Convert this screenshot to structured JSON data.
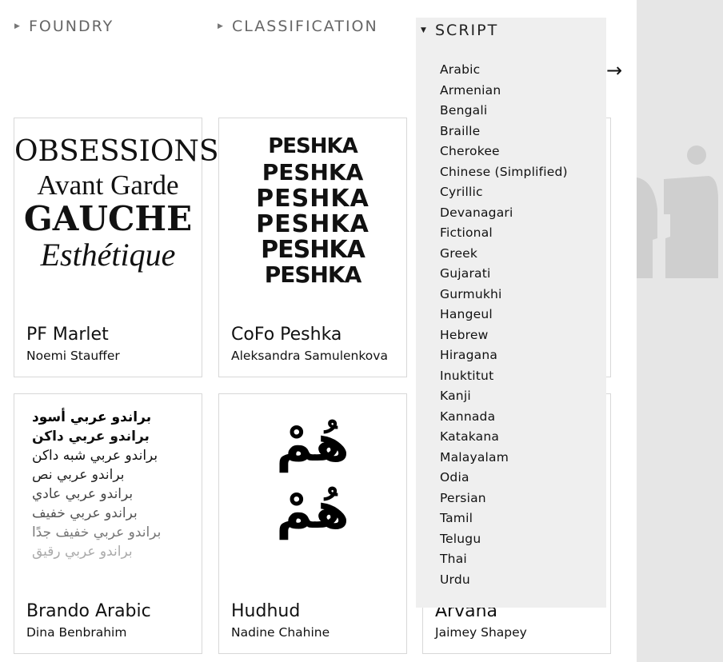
{
  "filters": {
    "foundry": "FOUNDRY",
    "classification": "CLASSIFICATION",
    "script": "SCRIPT"
  },
  "script_options": [
    "Arabic",
    "Armenian",
    "Bengali",
    "Braille",
    "Cherokee",
    "Chinese (Simplified)",
    "Cyrillic",
    "Devanagari",
    "Fictional",
    "Greek",
    "Gujarati",
    "Gurmukhi",
    "Hangeul",
    "Hebrew",
    "Hiragana",
    "Inuktitut",
    "Kanji",
    "Kannada",
    "Katakana",
    "Malayalam",
    "Odia",
    "Persian",
    "Tamil",
    "Telugu",
    "Thai",
    "Urdu"
  ],
  "next_arrow": "→",
  "cards": [
    {
      "name": "PF Marlet",
      "designer": "Noemi Stauffer",
      "specimen": [
        "OBSESSIONS",
        "Avant Garde",
        "GAUCHE",
        "Esthétique"
      ]
    },
    {
      "name": "CoFo Peshka",
      "designer": "Aleksandra Samulenkova",
      "specimen": [
        "PESHKA",
        "PESHKA",
        "PESHKA",
        "PESHKA",
        "PESHKA",
        "PESHKA"
      ]
    },
    {
      "name": "",
      "designer": ""
    },
    {
      "name": "Brando Arabic",
      "designer": "Dina Benbrahim",
      "specimen": [
        "براندو عربي أسود",
        "براندو عربي داكن",
        "براندو عربي شبه داكن",
        "براندو عربي نص",
        "براندو عربي عادي",
        "براندو عربي خفيف",
        "براندو عربي خفيف جدًا",
        "براندو عربي رقيق"
      ]
    },
    {
      "name": "Hudhud",
      "designer": "Nadine Chahine",
      "specimen": [
        "هُمْ",
        "هُمْ"
      ]
    },
    {
      "name": "Arvana",
      "designer": "Jaimey Shapey"
    }
  ],
  "colors": {
    "panel": "#efefef",
    "sidebar": "#e6e6e6",
    "border": "#d8d8d8"
  }
}
